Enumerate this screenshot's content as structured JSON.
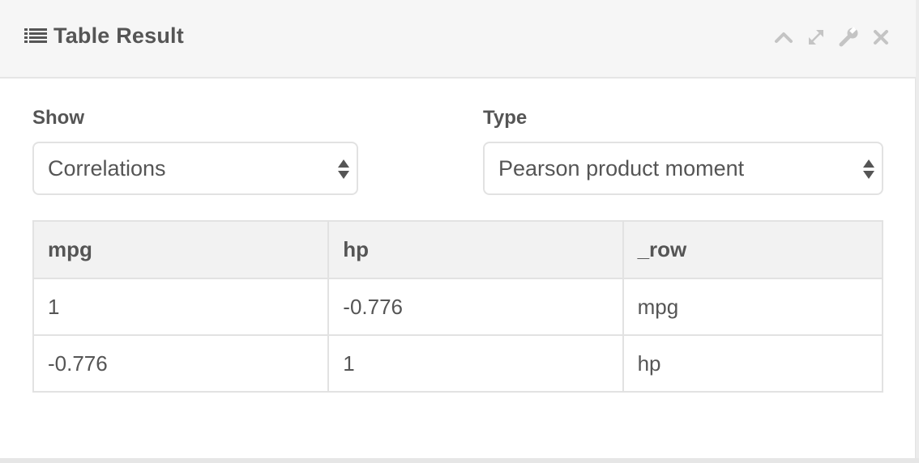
{
  "panel": {
    "title": "Table Result",
    "title_icon": "list-icon",
    "controls": [
      {
        "name": "collapse",
        "icon": "chevron-up-icon"
      },
      {
        "name": "expand",
        "icon": "expand-arrows-icon"
      },
      {
        "name": "settings",
        "icon": "wrench-icon"
      },
      {
        "name": "close",
        "icon": "close-icon"
      }
    ]
  },
  "filters": {
    "show": {
      "label": "Show",
      "value": "Correlations"
    },
    "type": {
      "label": "Type",
      "value": "Pearson product moment"
    }
  },
  "table": {
    "headers": [
      "mpg",
      "hp",
      "_row"
    ],
    "rows": [
      [
        "1",
        "-0.776",
        "mpg"
      ],
      [
        "-0.776",
        "1",
        "hp"
      ]
    ]
  },
  "colors": {
    "header_bg": "#f6f6f6",
    "text": "#555555",
    "icon": "#c4c4c4",
    "border": "#e2e2e2"
  }
}
